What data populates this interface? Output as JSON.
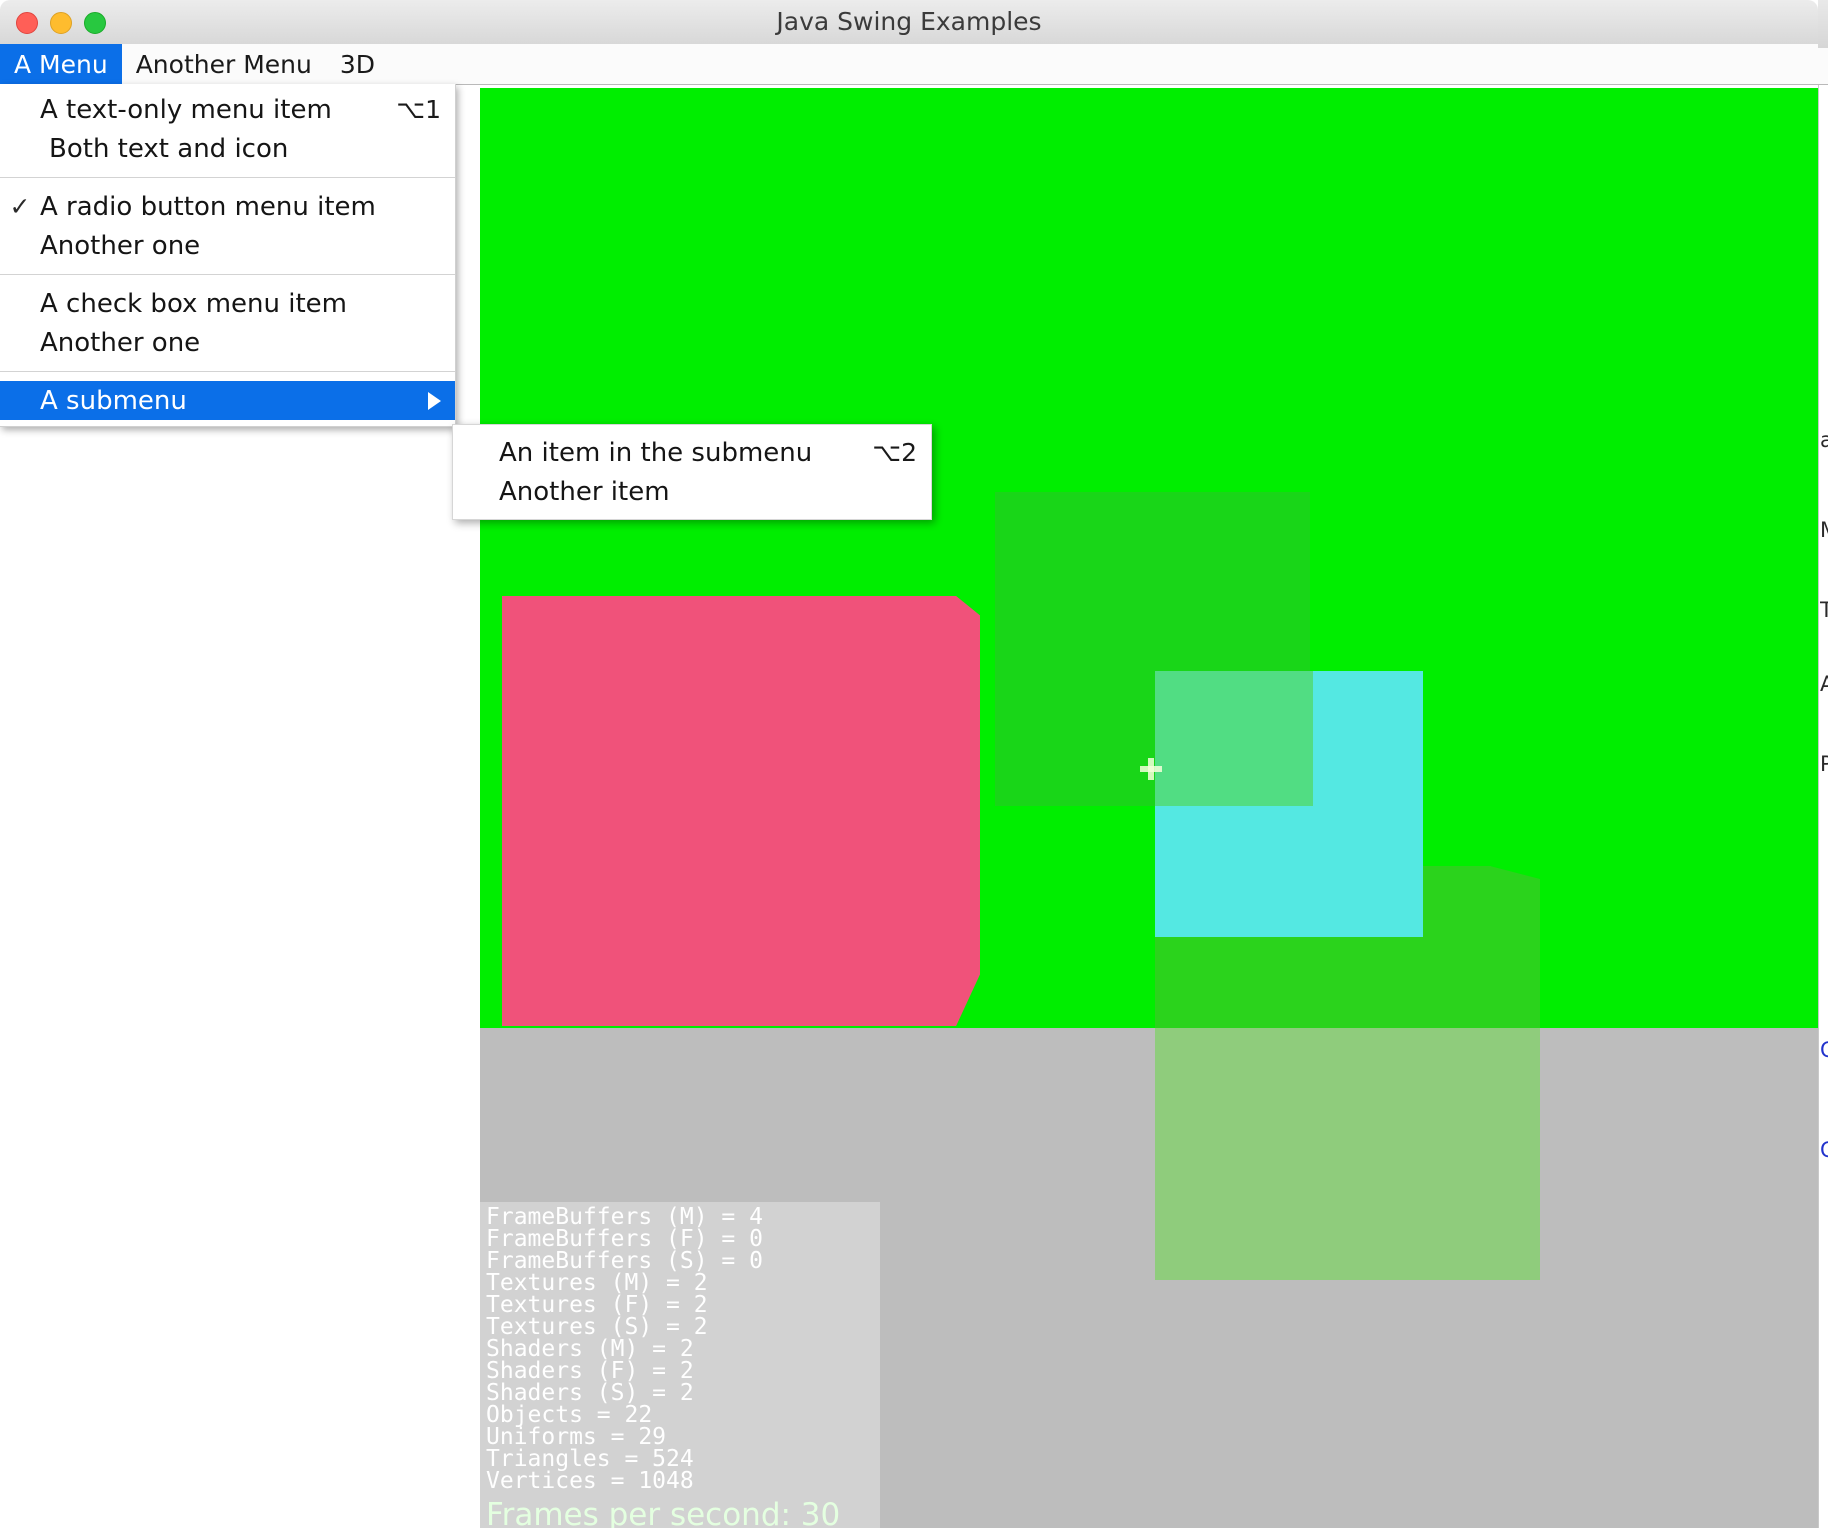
{
  "window": {
    "title": "Java Swing Examples",
    "traffic_lights": [
      {
        "name": "close",
        "color": "#ff5f57"
      },
      {
        "name": "minimize",
        "color": "#febc2e"
      },
      {
        "name": "maximize",
        "color": "#28c840"
      }
    ]
  },
  "menubar": {
    "items": [
      {
        "label": "A Menu",
        "active": true
      },
      {
        "label": "Another Menu",
        "active": false
      },
      {
        "label": "3D",
        "active": false
      }
    ]
  },
  "dropdown": {
    "groups": [
      {
        "items": [
          {
            "label": "A text-only menu item",
            "accel": "⌥1",
            "check": "",
            "indent": false,
            "selected": false,
            "submenu": false
          },
          {
            "label": "Both text and icon",
            "accel": "",
            "check": "",
            "indent": true,
            "selected": false,
            "submenu": false
          }
        ]
      },
      {
        "items": [
          {
            "label": "A radio button menu item",
            "accel": "",
            "check": "✓",
            "indent": false,
            "selected": false,
            "submenu": false
          },
          {
            "label": "Another one",
            "accel": "",
            "check": "",
            "indent": false,
            "selected": false,
            "submenu": false
          }
        ]
      },
      {
        "items": [
          {
            "label": "A check box menu item",
            "accel": "",
            "check": "",
            "indent": false,
            "selected": false,
            "submenu": false
          },
          {
            "label": "Another one",
            "accel": "",
            "check": "",
            "indent": false,
            "selected": false,
            "submenu": false
          }
        ]
      },
      {
        "items": [
          {
            "label": "A submenu",
            "accel": "",
            "check": "",
            "indent": false,
            "selected": true,
            "submenu": true
          }
        ]
      }
    ]
  },
  "submenu": {
    "items": [
      {
        "label": "An item in the submenu",
        "accel": "⌥2"
      },
      {
        "label": "Another item",
        "accel": ""
      }
    ]
  },
  "canvas": {
    "sky_color": "#00ee00",
    "ground_color": "#bdbdbd",
    "shapes": [
      {
        "name": "green-back-square",
        "color": "#19d618"
      },
      {
        "name": "pink-beveled-square",
        "color": "#f0527a"
      },
      {
        "name": "cyan-square",
        "color": "#54e8e2"
      },
      {
        "name": "green-cyan-overlap",
        "color": "#51dd83"
      },
      {
        "name": "light-green-square",
        "color": "#8fcc7c"
      },
      {
        "name": "green-front-top",
        "color": "#2bd31c"
      }
    ],
    "crosshair": "+"
  },
  "stats": {
    "lines": [
      "FrameBuffers (M) = 4",
      "FrameBuffers (F) = 0",
      "FrameBuffers (S) = 0",
      "Textures (M) = 2",
      "Textures (F) = 2",
      "Textures (S) = 2",
      "Shaders (M) = 2",
      "Shaders (F) = 2",
      "Shaders (S) = 2",
      "Objects = 22",
      "Uniforms = 29",
      "Triangles = 524",
      "Vertices = 1048"
    ],
    "fps": "Frames per second: 30"
  },
  "background_window": {
    "text_slivers": [
      "a",
      "M",
      "T",
      "A",
      "P",
      "C",
      "C"
    ]
  }
}
